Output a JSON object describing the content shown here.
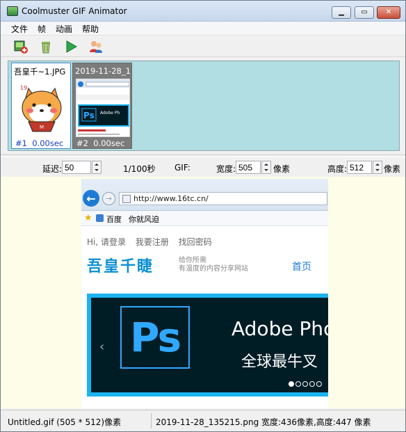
{
  "window": {
    "title": "Coolmuster GIF Animator"
  },
  "menu": [
    "文件",
    "帧",
    "动画",
    "帮助"
  ],
  "toolbar": {
    "icons": [
      "add-frame-icon",
      "delete-frame-icon",
      "play-icon",
      "users-icon"
    ]
  },
  "frames": [
    {
      "name": "吾皇千~1.JPG",
      "index": "#1",
      "delay": "0.00sec",
      "selected": true
    },
    {
      "name": "2019-11-28_1",
      "index": "#2",
      "delay": "0.00sec",
      "selected": false
    }
  ],
  "thumb1": {
    "label1": "19",
    "label2": "M"
  },
  "thumb2": {
    "ps": "Ps",
    "adobe": "Adobe Ph"
  },
  "props": {
    "delay_label": "延迟:",
    "delay_value": "50",
    "unit_label": "1/100秒",
    "gif_label": "GIF:",
    "width_label": "宽度:",
    "width_value": "505",
    "width_unit": "像素",
    "height_label": "高度:",
    "height_value": "512",
    "height_unit": "像素"
  },
  "preview": {
    "address": "http://www.16tc.cn/",
    "fav_items": [
      "百度",
      "你就风迫"
    ],
    "nav_links": [
      "Hi, 请登录",
      "我要注册",
      "找回密码"
    ],
    "logo": "吾皇千睫",
    "slogan_line1": "给你所需",
    "slogan_line2": "有温度的内容分享网站",
    "home": "首页",
    "banner_ps": "Ps",
    "banner_title": "Adobe Pho",
    "banner_subtitle": "全球最牛叉",
    "slider_arrow": "‹"
  },
  "status": {
    "left": "Untitled.gif (505 * 512)像素",
    "right": "2019-11-28_135215.png 宽度:436像素,高度:447 像素"
  },
  "colors": {
    "frame_strip_bg": "#b0dee2",
    "canvas_bg": "#fdfde8",
    "accent_blue": "#1bb4ee",
    "ps_blue": "#31a8ff"
  }
}
